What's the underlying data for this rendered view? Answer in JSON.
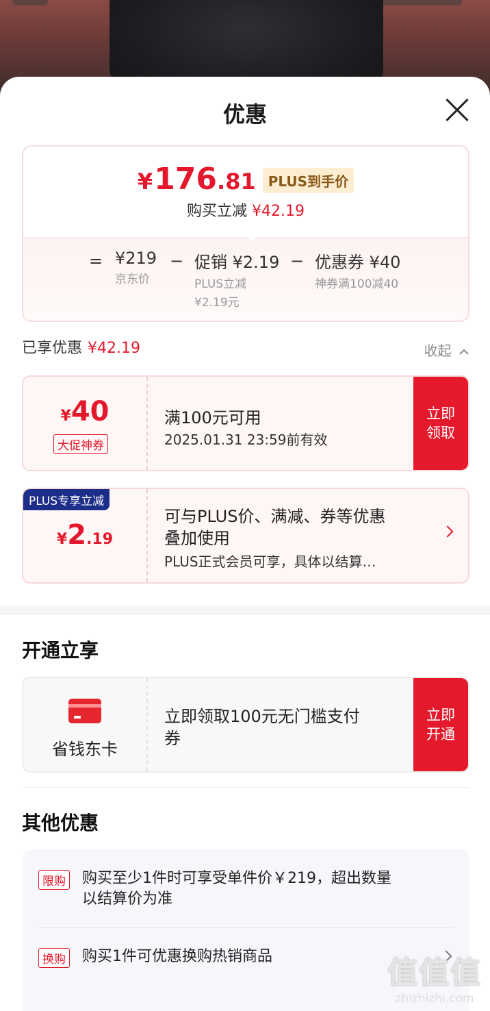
{
  "sheet": {
    "title": "优惠"
  },
  "price_card": {
    "currency": "¥",
    "price_int": "176",
    "price_dec": ".81",
    "plus_tag": "PLUS到手价",
    "reduce_label": "购买立减",
    "reduce_amount": "¥42.19",
    "eq": "=",
    "minus": "−",
    "jd_price": "¥219",
    "jd_price_label": "京东价",
    "promo": "促销 ¥2.19",
    "promo_sub1": "PLUS立减",
    "promo_sub2": "¥2.19元",
    "coupon": "优惠券 ¥40",
    "coupon_sub": "神券满100减40"
  },
  "enjoyed": {
    "label": "已享优惠",
    "amount": "¥42.19",
    "collapse": "收起"
  },
  "coupons": [
    {
      "yen": "¥",
      "amount": "40",
      "tag": "大促神券",
      "line1": "满100元可用",
      "line2": "2025.01.31 23:59前有效",
      "action": "立即\n领取"
    },
    {
      "ribbon": "PLUS专享立减",
      "yen": "¥",
      "amount": "2",
      "dec": ".19",
      "line1": "可与PLUS价、满减、券等优惠",
      "line1b": "叠加使用",
      "line2": "PLUS正式会员可享，具体以结算…"
    }
  ],
  "open_section": {
    "title": "开通立享",
    "card_name": "省钱东卡",
    "text1": "立即领取100元无门槛支付",
    "text2": "券",
    "action": "立即\n开通",
    "icon": "red-card-icon"
  },
  "other_section": {
    "title": "其他优惠",
    "items": [
      {
        "tag": "限购",
        "text1": "购买至少1件时可享受单件价￥219，超出数量",
        "text2": "以结算价为准"
      },
      {
        "tag": "换购",
        "text1": "购买1件可优惠换购热销商品"
      }
    ]
  },
  "watermark": {
    "logo": "值值值",
    "url": "zhizhizhi.com"
  },
  "colors": {
    "accent": "#e4182c",
    "plus_blue": "#1c2d8a",
    "plus_gold": "#fdeed1"
  }
}
